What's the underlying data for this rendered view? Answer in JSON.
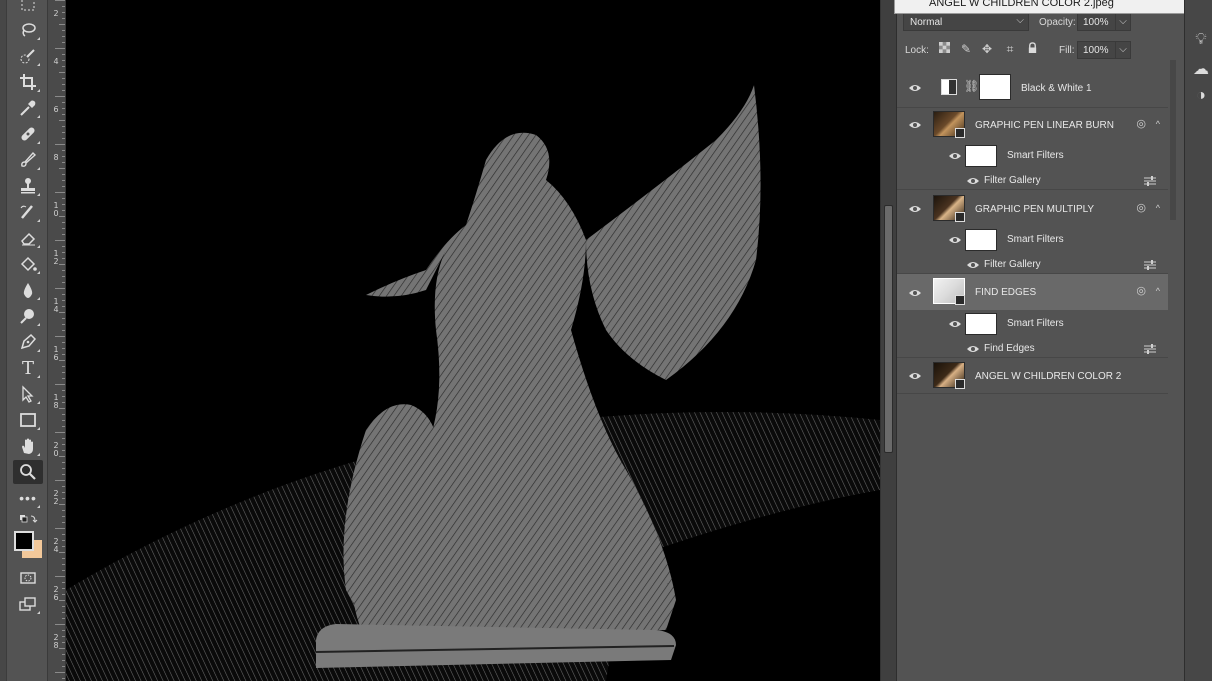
{
  "tooltip": {
    "filename": "ANGEL W CHILDREN COLOR 2.jpeg"
  },
  "layers_panel": {
    "blend_mode": "Normal",
    "opacity_label": "Opacity:",
    "opacity_value": "100%",
    "lock_label": "Lock:",
    "fill_label": "Fill:",
    "fill_value": "100%",
    "layers": [
      {
        "name": "Black & White 1",
        "type": "adjustment"
      },
      {
        "name": "GRAPHIC PEN LINEAR BURN",
        "type": "smart-object",
        "smart_filters_label": "Smart Filters",
        "filter": "Filter Gallery"
      },
      {
        "name": "GRAPHIC PEN MULTIPLY",
        "type": "smart-object",
        "smart_filters_label": "Smart Filters",
        "filter": "Filter Gallery"
      },
      {
        "name": "FIND EDGES",
        "type": "smart-object",
        "selected": true,
        "smart_filters_label": "Smart Filters",
        "filter": "Find Edges"
      },
      {
        "name": "ANGEL W CHILDREN COLOR 2",
        "type": "smart-object"
      }
    ]
  },
  "ruler": {
    "labels": [
      "2",
      "4",
      "6",
      "8",
      "10",
      "12",
      "14",
      "16",
      "18",
      "20",
      "22",
      "24",
      "26",
      "28"
    ]
  },
  "toolbar": {
    "tools": [
      "marquee-tool",
      "lasso-tool",
      "quick-select-tool",
      "crop-tool",
      "eyedropper-tool",
      "healing-brush-tool",
      "brush-tool",
      "clone-stamp-tool",
      "history-brush-tool",
      "eraser-tool",
      "paint-bucket-tool",
      "blur-tool",
      "dodge-tool",
      "pen-tool",
      "type-tool",
      "path-select-tool",
      "rectangle-tool",
      "hand-tool",
      "zoom-tool",
      "more-tools"
    ],
    "foreground_color": "#000000",
    "background_color": "#f2c89a"
  }
}
